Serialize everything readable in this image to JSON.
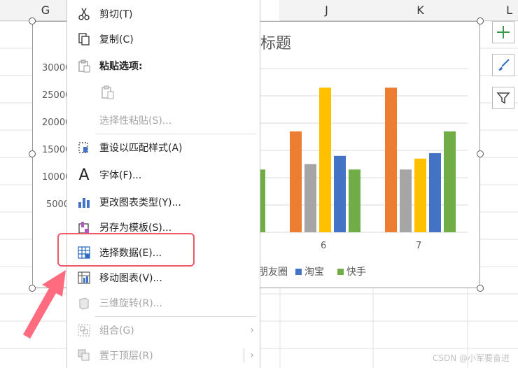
{
  "columns": {
    "g": "G",
    "j": "J",
    "k": "K",
    "l": "L"
  },
  "chart": {
    "title_partial": "标题",
    "yticks": [
      "30000",
      "25000",
      "20000",
      "15000",
      "10000",
      "5000"
    ],
    "categories_visible": [
      "6",
      "7"
    ],
    "legend": [
      "朋友圈",
      "淘宝",
      "快手"
    ]
  },
  "chart_data": {
    "type": "bar",
    "title": "标题",
    "categories": [
      "6",
      "7"
    ],
    "series": [
      {
        "name": "",
        "values": [
          18500,
          26500
        ],
        "color": "#ed7d31"
      },
      {
        "name": "朋友圈",
        "values": [
          12500,
          11500
        ],
        "color": "#a5a5a5"
      },
      {
        "name": "",
        "values": [
          26500,
          13500
        ],
        "color": "#ffc000"
      },
      {
        "name": "淘宝",
        "values": [
          14000,
          14500
        ],
        "color": "#4472c4"
      },
      {
        "name": "快手",
        "values": [
          11500,
          18500
        ],
        "color": "#70ad47"
      }
    ],
    "ylim": [
      0,
      30000
    ]
  },
  "menu": {
    "cut": "剪切(T)",
    "copy": "复制(C)",
    "paste_options": "粘贴选项:",
    "paste_special": "选择性粘贴(S)...",
    "reset_style": "重设以匹配样式(A)",
    "font": "字体(F)...",
    "change_chart_type": "更改图表类型(Y)...",
    "save_template": "另存为模板(S)...",
    "select_data": "选择数据(E)...",
    "move_chart": "移动图表(V)...",
    "rotate_3d": "三维旋转(R)...",
    "group": "组合(G)",
    "bring_front": "置于顶层(R)"
  },
  "watermark": "CSDN @小军要奋进",
  "icons": [
    "scissors-icon",
    "copy-icon",
    "paste-icon",
    "reset-style-icon",
    "font-icon",
    "chart-type-icon",
    "template-icon",
    "select-data-icon",
    "move-chart-icon",
    "rotate-3d-icon",
    "group-icon",
    "bring-front-icon"
  ]
}
